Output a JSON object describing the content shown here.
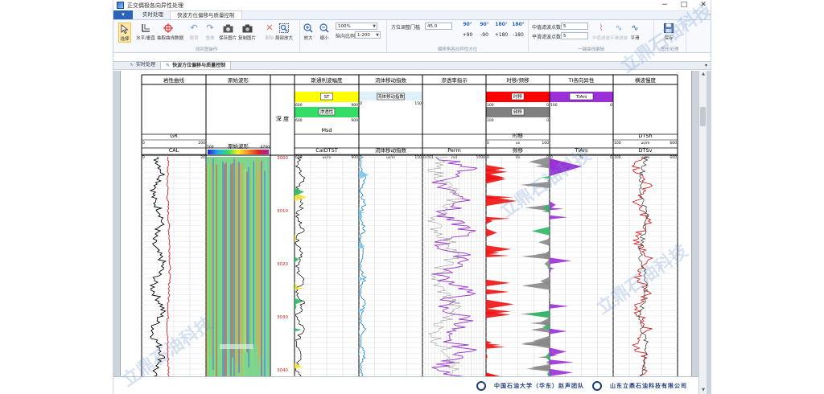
{
  "window": {
    "title": "正交偶极各向异性处理",
    "controls": [
      "−",
      "□",
      "✕"
    ]
  },
  "ribbon_tabs": [
    {
      "label": "实时处理"
    },
    {
      "label": "快波方位偏移与质量控制"
    }
  ],
  "menu_button": "▾",
  "ribbon": {
    "groups": [
      "测井图操作",
      "偏移角各向异性方位",
      "一键曲线编辑",
      "图形处理"
    ],
    "tools": [
      {
        "label": "选择",
        "icon": "pointer-icon"
      },
      {
        "label": "水平/垂直",
        "icon": "axis-icon"
      },
      {
        "label": "抽取曲线数据",
        "icon": "target-icon"
      },
      {
        "label": "撤销",
        "icon": "undo-icon"
      },
      {
        "label": "重做",
        "icon": "redo-icon"
      },
      {
        "label": "保存图片",
        "icon": "camera-icon"
      },
      {
        "label": "复制图片",
        "icon": "copy-image-icon"
      },
      {
        "label": "删除",
        "icon": "delete-icon"
      },
      {
        "label": "局部放大",
        "icon": "zoom-region-icon"
      },
      {
        "label": "放大",
        "icon": "zoom-in-icon"
      },
      {
        "label": "缩小",
        "icon": "zoom-out-icon"
      }
    ],
    "zoom": {
      "value": "100%",
      "scale_label": "纵向比例",
      "scale_value": "1:200"
    },
    "azimuth": {
      "label": "方位调整门槛",
      "value": "45.0"
    },
    "rotate_buttons": [
      {
        "top": "90°",
        "bottom": "+90"
      },
      {
        "top": "90°",
        "bottom": "-90"
      },
      {
        "top": "180°",
        "bottom": "+180"
      },
      {
        "top": "180°",
        "bottom": "-180"
      }
    ],
    "filter": {
      "median_label": "中值滤波点数",
      "median_value": "5",
      "smooth_label": "平滑滤波点数",
      "smooth_value": "5"
    },
    "filter_buttons": [
      "中值滤波",
      "平滑滤波",
      "平滑"
    ],
    "save_label": "保存"
  },
  "doc_tabs": [
    {
      "label": "实时处理",
      "glyph": "∿"
    },
    {
      "label": "快波方位偏移与质量控制",
      "glyph": "✎"
    }
  ],
  "log": {
    "tracks": [
      {
        "name": "岩性曲线"
      },
      {
        "name": "原始波形"
      },
      {
        "name": "深 度"
      },
      {
        "name": "斯通利波幅度"
      },
      {
        "name": "流体移动指数"
      },
      {
        "name": "渗透率指示"
      },
      {
        "name": "时移/频移"
      },
      {
        "name": "TI各向异性"
      },
      {
        "name": "横波慢度"
      }
    ],
    "curves": {
      "gr": {
        "name": "GR",
        "min": "0",
        "max": "200"
      },
      "cal": {
        "name": "CAL",
        "min": "0",
        "max": "20"
      },
      "wave": {
        "name": "原始波形",
        "min": "500",
        "max": "4700"
      },
      "st_top": {
        "label": "ST",
        "min": "600",
        "max": "900",
        "color": "#ffff00"
      },
      "perm_fill": {
        "label": "渗透性",
        "min": "600",
        "max": "900",
        "color": "#33dd66"
      },
      "msd": {
        "name": "Msd"
      },
      "caldtst": {
        "name": "CalDTST",
        "min": "600",
        "unit": "us/m",
        "max": "900"
      },
      "fmi_top": {
        "label": "流体移动指数",
        "min": "0",
        "max": "150"
      },
      "fmi": {
        "name": "流体移动指数",
        "min": "0",
        "unit": "us/m",
        "max": "150"
      },
      "perm": {
        "name": "Perm",
        "min": "0.001",
        "unit": "md",
        "max": "1000"
      },
      "shift_top": {
        "label": "时移",
        "min": "100",
        "max": "0",
        "color": "#ff0000"
      },
      "freq_top": {
        "label": "频移",
        "min": "100",
        "max": "0",
        "color": "#808080"
      },
      "time_shift": {
        "name": "时移",
        "min": "0",
        "unit": "us",
        "max": "100"
      },
      "freq_shift": {
        "name": "频移",
        "min": "0",
        "unit": "Hz",
        "max": "0"
      },
      "tiani_top": {
        "label": "TIAni",
        "min": "100",
        "max": "0",
        "color": "#9b30d9"
      },
      "tiani": {
        "name": "TIAni",
        "min": "0",
        "unit": "%",
        "max": "0"
      },
      "dtsh": {
        "name": "DTSh",
        "min": "100",
        "unit": "us/m",
        "max": "600"
      },
      "dtsv": {
        "name": "DTSv",
        "min": "100",
        "unit": "us/m",
        "max": "600"
      }
    },
    "depths": [
      "3000",
      "3010",
      "3020",
      "3030",
      "3040"
    ]
  },
  "footer": {
    "university": "中国石油大学（华东）赵声团队",
    "company": "山东立鼎石油科技有限公司"
  },
  "watermark": "立鼎石油科技",
  "colors": {
    "accent": "#2a63b8",
    "depth": "#cc2222",
    "cal_curve": "#cc2222",
    "gr_curve": "#000000",
    "fmi_curve": "#2b8fd6",
    "perm_curve": "#9a3cc8",
    "tiani_fill": "#9b30d9",
    "green_fill": "#2fb866"
  }
}
